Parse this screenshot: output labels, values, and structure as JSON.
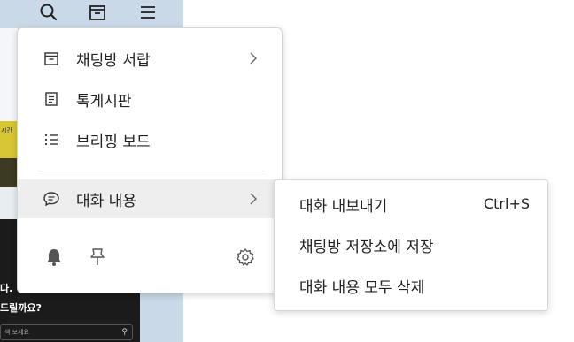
{
  "background_app": {
    "yellow_banner_text": "시간",
    "dark_text_line1": "다.",
    "dark_text_line2": "드릴까요?",
    "search_placeholder": "색 보세요"
  },
  "context_menu": {
    "items": [
      {
        "label": "채팅방 서랍",
        "icon": "drawer-icon",
        "has_submenu": true
      },
      {
        "label": "톡게시판",
        "icon": "board-icon",
        "has_submenu": false
      },
      {
        "label": "브리핑 보드",
        "icon": "list-icon",
        "has_submenu": false
      },
      {
        "label": "대화 내용",
        "icon": "chat-bubble-icon",
        "has_submenu": true
      }
    ],
    "bottom_icons": [
      "bell-icon",
      "pin-icon",
      "gear-icon"
    ]
  },
  "submenu": {
    "items": [
      {
        "label": "대화 내보내기",
        "shortcut": "Ctrl+S"
      },
      {
        "label": "채팅방 저장소에 저장"
      },
      {
        "label": "대화 내용 모두 삭제"
      }
    ]
  },
  "colors": {
    "left_panel": "#c9d9e8",
    "menu_bg": "#ffffff",
    "highlight": "#eeeeee",
    "text": "#222222"
  }
}
